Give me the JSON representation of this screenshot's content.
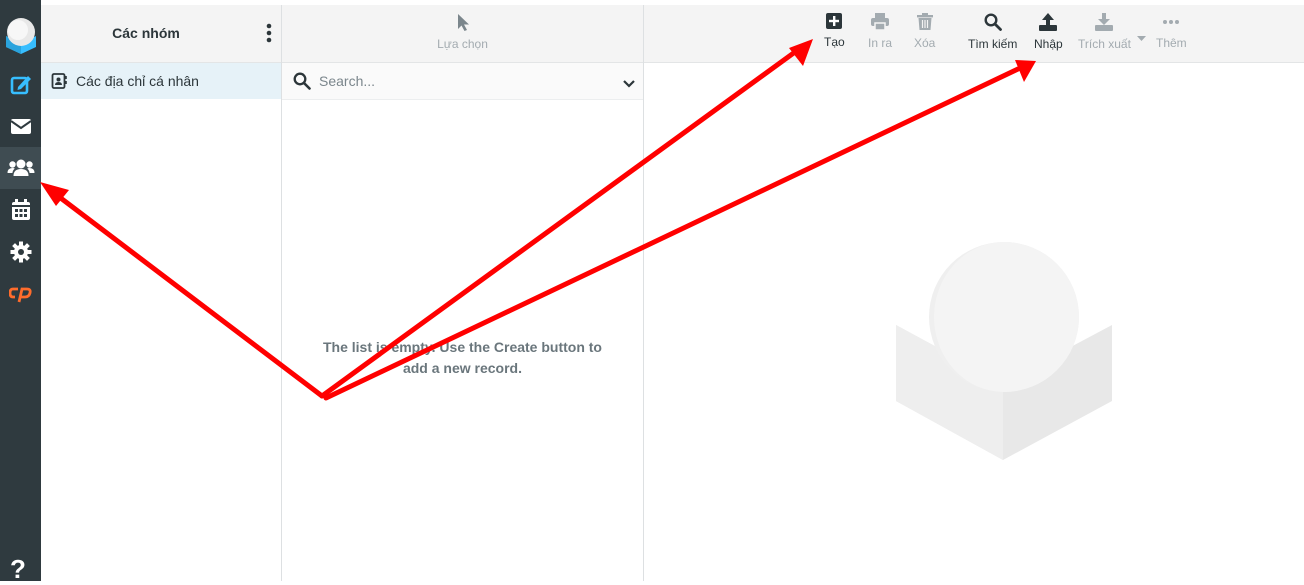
{
  "groups": {
    "title": "Các nhóm",
    "items": [
      {
        "label": "Các địa chỉ cá nhân"
      }
    ]
  },
  "list_toolbar": {
    "select_label": "Lựa chọn"
  },
  "toolbar": {
    "create_label": "Tạo",
    "print_label": "In ra",
    "delete_label": "Xóa",
    "search_label": "Tìm kiếm",
    "import_label": "Nhập",
    "export_label": "Trích xuất",
    "more_label": "Thêm"
  },
  "search": {
    "placeholder": "Search..."
  },
  "list": {
    "empty_message": "The list is empty. Use the Create button to add a new record."
  },
  "nav": {
    "items": [
      "compose-icon",
      "mail-icon",
      "contacts-icon",
      "calendar-icon",
      "settings-icon",
      "cpanel-icon"
    ],
    "active": "contacts-icon",
    "help_label": "?"
  },
  "colors": {
    "nav_bg": "#2f3a3f",
    "accent_blue": "#37beff",
    "cpanel_orange": "#ff6c2c",
    "annotation_red": "#ff0000",
    "selected_bg": "#e6f2f8"
  }
}
